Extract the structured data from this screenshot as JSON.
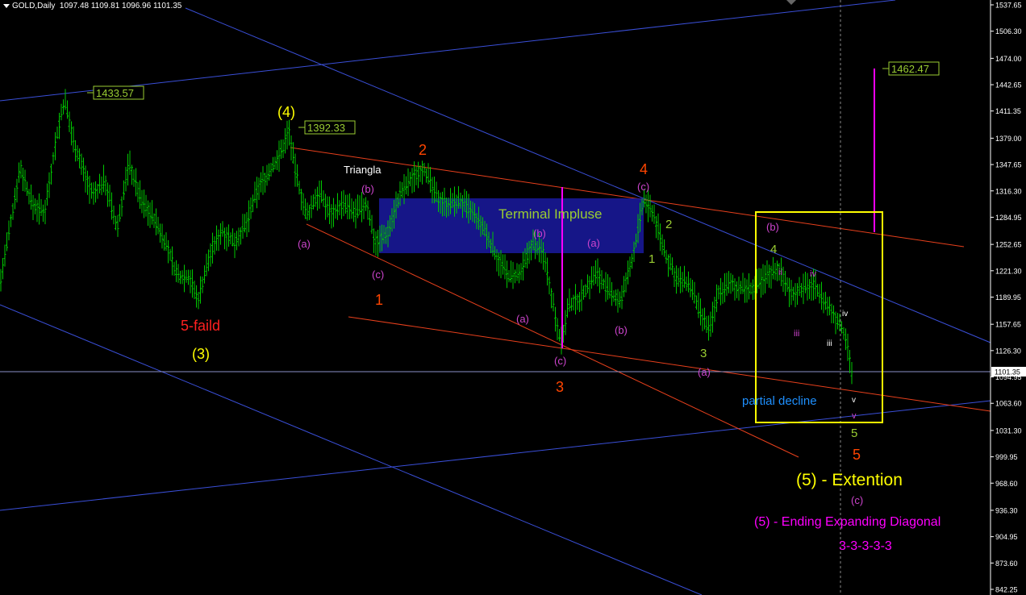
{
  "header": {
    "symbol": "GOLD,Daily",
    "ohlc": "1097.48 1109.81 1096.96 1101.35"
  },
  "colors": {
    "background": "#000000",
    "candles": "#00c800",
    "blue_lines": "#3a4fd8",
    "red_lines": "#e8401c",
    "yellow": "#ffff00",
    "magenta": "#ff00ff",
    "green_label": "#9acd32",
    "orange_label": "#ff4500",
    "axis_text": "#ffffff"
  },
  "chart_data": {
    "type": "candlestick",
    "symbol": "GOLD",
    "timeframe": "Daily",
    "ylim": [
      842.25,
      1537.65
    ],
    "y_ticks": [
      1537.65,
      1506.3,
      1474.0,
      1442.65,
      1411.35,
      1379.0,
      1347.65,
      1316.3,
      1284.95,
      1252.65,
      1221.3,
      1189.95,
      1157.65,
      1126.3,
      1094.95,
      1063.6,
      1031.3,
      999.95,
      968.6,
      936.3,
      904.95,
      873.6,
      842.25
    ],
    "current_price": "1101.35",
    "price_path": [
      [
        0,
        1205
      ],
      [
        10,
        1260
      ],
      [
        25,
        1345
      ],
      [
        40,
        1300
      ],
      [
        55,
        1290
      ],
      [
        70,
        1380
      ],
      [
        80,
        1425
      ],
      [
        90,
        1380
      ],
      [
        100,
        1350
      ],
      [
        115,
        1310
      ],
      [
        130,
        1330
      ],
      [
        145,
        1270
      ],
      [
        160,
        1350
      ],
      [
        175,
        1305
      ],
      [
        190,
        1285
      ],
      [
        205,
        1255
      ],
      [
        220,
        1215
      ],
      [
        235,
        1215
      ],
      [
        245,
        1185
      ],
      [
        260,
        1240
      ],
      [
        275,
        1270
      ],
      [
        290,
        1255
      ],
      [
        305,
        1275
      ],
      [
        320,
        1320
      ],
      [
        335,
        1340
      ],
      [
        350,
        1365
      ],
      [
        358,
        1390
      ],
      [
        365,
        1345
      ],
      [
        380,
        1285
      ],
      [
        395,
        1315
      ],
      [
        410,
        1290
      ],
      [
        425,
        1300
      ],
      [
        440,
        1290
      ],
      [
        455,
        1300
      ],
      [
        465,
        1255
      ],
      [
        480,
        1265
      ],
      [
        495,
        1310
      ],
      [
        510,
        1330
      ],
      [
        525,
        1345
      ],
      [
        540,
        1310
      ],
      [
        555,
        1300
      ],
      [
        570,
        1305
      ],
      [
        585,
        1290
      ],
      [
        600,
        1270
      ],
      [
        615,
        1240
      ],
      [
        630,
        1215
      ],
      [
        645,
        1215
      ],
      [
        660,
        1255
      ],
      [
        675,
        1240
      ],
      [
        688,
        1170
      ],
      [
        696,
        1135
      ],
      [
        705,
        1180
      ],
      [
        720,
        1190
      ],
      [
        740,
        1220
      ],
      [
        755,
        1195
      ],
      [
        770,
        1185
      ],
      [
        785,
        1240
      ],
      [
        798,
        1305
      ],
      [
        810,
        1290
      ],
      [
        825,
        1240
      ],
      [
        840,
        1210
      ],
      [
        855,
        1205
      ],
      [
        870,
        1165
      ],
      [
        880,
        1150
      ],
      [
        890,
        1195
      ],
      [
        905,
        1205
      ],
      [
        920,
        1200
      ],
      [
        935,
        1200
      ],
      [
        950,
        1215
      ],
      [
        965,
        1225
      ],
      [
        980,
        1195
      ],
      [
        995,
        1200
      ],
      [
        1010,
        1205
      ],
      [
        1025,
        1180
      ],
      [
        1040,
        1160
      ],
      [
        1050,
        1140
      ],
      [
        1056,
        1100
      ]
    ],
    "price_labels": [
      {
        "value": "1433.57",
        "price": 1433.57
      },
      {
        "value": "1392.33",
        "price": 1392.33
      },
      {
        "value": "1462.47",
        "price": 1462.47
      }
    ],
    "annotations": [
      {
        "text": "(4)",
        "color": "#ffff00",
        "size": 18
      },
      {
        "text": "5-faild",
        "color": "#ff2020",
        "size": 18
      },
      {
        "text": "(3)",
        "color": "#ffff00",
        "size": 18
      },
      {
        "text": "Triangla",
        "color": "#ffffff",
        "size": 13
      },
      {
        "text": "2",
        "color": "#ff4500",
        "size": 18
      },
      {
        "text": "1",
        "color": "#ff4500",
        "size": 18
      },
      {
        "text": "3",
        "color": "#ff4500",
        "size": 18
      },
      {
        "text": "4",
        "color": "#ff4500",
        "size": 18
      },
      {
        "text": "5",
        "color": "#ff4500",
        "size": 18
      },
      {
        "text": "Terminal Impluse",
        "color": "#9acd32",
        "size": 17
      },
      {
        "text": "(b)",
        "color": "#cc44cc",
        "size": 13
      },
      {
        "text": "(a)",
        "color": "#cc44cc",
        "size": 13
      },
      {
        "text": "(c)",
        "color": "#cc44cc",
        "size": 13
      },
      {
        "text": "(b)",
        "color": "#cc44cc",
        "size": 13
      },
      {
        "text": "(a)",
        "color": "#cc44cc",
        "size": 13
      },
      {
        "text": "(a)",
        "color": "#cc44cc",
        "size": 13
      },
      {
        "text": "(c)",
        "color": "#cc44cc",
        "size": 13
      },
      {
        "text": "(b)",
        "color": "#cc44cc",
        "size": 13
      },
      {
        "text": "(c)",
        "color": "#cc44cc",
        "size": 13
      },
      {
        "text": "(a)",
        "color": "#cc44cc",
        "size": 13
      },
      {
        "text": "(b)",
        "color": "#cc44cc",
        "size": 13
      },
      {
        "text": "(c)",
        "color": "#cc44cc",
        "size": 13
      },
      {
        "text": "1",
        "color": "#9acd32",
        "size": 15
      },
      {
        "text": "2",
        "color": "#9acd32",
        "size": 15
      },
      {
        "text": "3",
        "color": "#9acd32",
        "size": 15
      },
      {
        "text": "4",
        "color": "#9acd32",
        "size": 15
      },
      {
        "text": "5",
        "color": "#9acd32",
        "size": 15
      },
      {
        "text": "ii",
        "color": "#cc44cc",
        "size": 11
      },
      {
        "text": "iii",
        "color": "#cc44cc",
        "size": 11
      },
      {
        "text": "iv",
        "color": "#cc44cc",
        "size": 11
      },
      {
        "text": "v",
        "color": "#cc44cc",
        "size": 11
      },
      {
        "text": "iii",
        "color": "#ffffff",
        "size": 10
      },
      {
        "text": "iv",
        "color": "#ffffff",
        "size": 10
      },
      {
        "text": "v",
        "color": "#ffffff",
        "size": 10
      },
      {
        "text": "partial decline",
        "color": "#1e90ff",
        "size": 15
      },
      {
        "text": "(5) -  Extention",
        "color": "#ffff00",
        "size": 21
      },
      {
        "text": "(5) - Ending Expanding Diagonal",
        "color": "#ff00ff",
        "size": 16
      },
      {
        "text": "3-3-3-3-3",
        "color": "#ff00ff",
        "size": 16
      }
    ]
  }
}
